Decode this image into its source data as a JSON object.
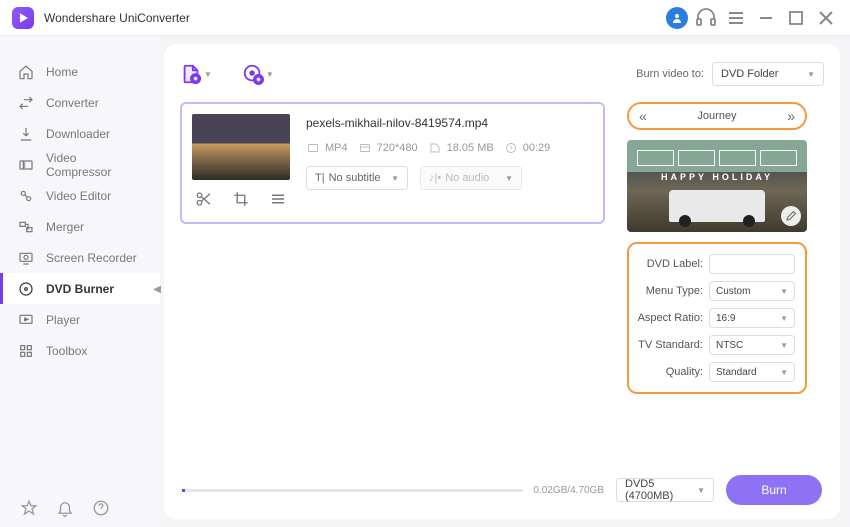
{
  "app": {
    "title": "Wondershare UniConverter"
  },
  "sidebar": {
    "items": [
      {
        "label": "Home"
      },
      {
        "label": "Converter"
      },
      {
        "label": "Downloader"
      },
      {
        "label": "Video Compressor"
      },
      {
        "label": "Video Editor"
      },
      {
        "label": "Merger"
      },
      {
        "label": "Screen Recorder"
      },
      {
        "label": "DVD Burner"
      },
      {
        "label": "Player"
      },
      {
        "label": "Toolbox"
      }
    ],
    "active_index": 7
  },
  "toolbar": {
    "burn_to_label": "Burn video to:",
    "burn_to_value": "DVD Folder"
  },
  "file": {
    "name": "pexels-mikhail-nilov-8419574.mp4",
    "format": "MP4",
    "resolution": "720*480",
    "size": "18.05 MB",
    "duration": "00:29",
    "subtitle": "No subtitle",
    "audio": "No audio"
  },
  "template": {
    "name": "Journey",
    "preview_title": "HAPPY HOLIDAY"
  },
  "settings": {
    "dvd_label_label": "DVD Label:",
    "dvd_label_value": "",
    "menu_type_label": "Menu Type:",
    "menu_type_value": "Custom",
    "aspect_label": "Aspect Ratio:",
    "aspect_value": "16:9",
    "tv_label": "TV Standard:",
    "tv_value": "NTSC",
    "quality_label": "Quality:",
    "quality_value": "Standard"
  },
  "footer": {
    "usage": "0.02GB/4.70GB",
    "disc": "DVD5 (4700MB)",
    "burn_label": "Burn"
  }
}
